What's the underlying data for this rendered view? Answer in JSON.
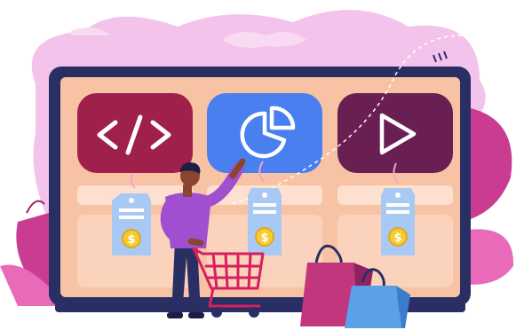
{
  "colors": {
    "cloud": "#f3c3ec",
    "cloud_light": "#f8daf2",
    "monitor_frame": "#2a2f63",
    "screen_bg": "#f8c3a4",
    "card_code": "#a0204c",
    "card_chart": "#4a7ff0",
    "card_play": "#6a1f52",
    "tag": "#a9c9f5",
    "coin": "#f5cc33",
    "shirt": "#a04fd0",
    "pants": "#2a2f63",
    "skin": "#8a4430",
    "cart": "#d81f5e",
    "bag_pink": "#c1367d",
    "bag_blue": "#5aa1e8",
    "leaf": "#c93c92"
  },
  "cards": [
    {
      "icon": "code-icon"
    },
    {
      "icon": "pie-chart-icon"
    },
    {
      "icon": "play-icon"
    }
  ],
  "price_symbol": "$"
}
